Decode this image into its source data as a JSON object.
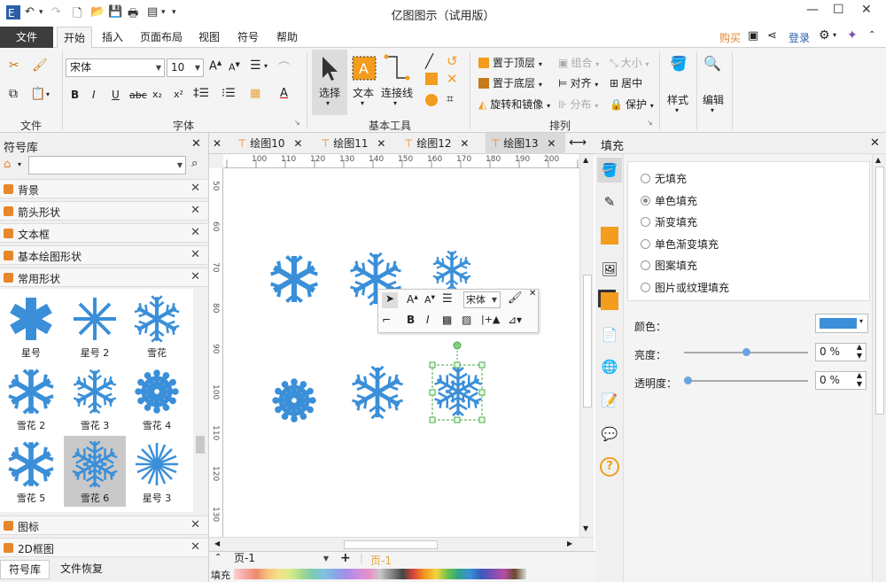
{
  "window": {
    "title": "亿图图示（试用版）"
  },
  "menu": {
    "file": "文件",
    "tabs": [
      "开始",
      "插入",
      "页面布局",
      "视图",
      "符号",
      "帮助"
    ],
    "right": {
      "buy": "购买",
      "login": "登录"
    }
  },
  "ribbon": {
    "groups": {
      "file": "文件",
      "font": "字体",
      "basic_tools": "基本工具",
      "arrange": "排列"
    },
    "font_name": "宋体",
    "font_size": "10",
    "tools": {
      "select": "选择",
      "text": "文本",
      "connector": "连接线"
    },
    "arrange": {
      "bring_top": "置于顶层",
      "send_bottom": "置于底层",
      "rotate_mirror": "旋转和镜像",
      "group": "组合",
      "align": "对齐",
      "distribute": "分布",
      "size": "大小",
      "center": "居中",
      "protect": "保护"
    },
    "style": "样式",
    "edit": "编辑"
  },
  "symbol_library": {
    "title": "符号库",
    "categories": [
      "背景",
      "箭头形状",
      "文本框",
      "基本绘图形状",
      "常用形状"
    ],
    "shapes": [
      {
        "label": "星号"
      },
      {
        "label": "星号 2"
      },
      {
        "label": "雪花"
      },
      {
        "label": "雪花 2"
      },
      {
        "label": "雪花 3"
      },
      {
        "label": "雪花 4"
      },
      {
        "label": "雪花 5"
      },
      {
        "label": "雪花 6"
      },
      {
        "label": "星号 3"
      }
    ],
    "bottom_categories": [
      "图标",
      "2D框图"
    ],
    "bottom_tabs": {
      "library": "符号库",
      "recovery": "文件恢复"
    }
  },
  "doc_tabs": [
    "绘图10",
    "绘图11",
    "绘图12",
    "绘图13"
  ],
  "ruler": {
    "h_ticks": [
      "100",
      "110",
      "120",
      "130",
      "140",
      "150",
      "160",
      "170",
      "180",
      "190",
      "200"
    ],
    "v_ticks": [
      "50",
      "60",
      "70",
      "80",
      "90",
      "100",
      "110",
      "120",
      "130"
    ]
  },
  "mini_toolbar": {
    "font": "宋体"
  },
  "page": {
    "select": "页-1",
    "current": "页-1",
    "fill_label": "填充"
  },
  "fill_panel": {
    "title": "填充",
    "options": [
      "无填充",
      "单色填充",
      "渐变填充",
      "单色渐变填充",
      "图案填充",
      "图片或纹理填充"
    ],
    "selected": 1,
    "color_label": "颜色：",
    "color_value": "#3a8fd8",
    "brightness_label": "亮度：",
    "brightness_value": "0 %",
    "transparency_label": "透明度：",
    "transparency_value": "0 %"
  },
  "colors": {
    "accent": "#3a8fd8",
    "snowflake": "#3a8fd8",
    "orange": "#f39c1e"
  }
}
